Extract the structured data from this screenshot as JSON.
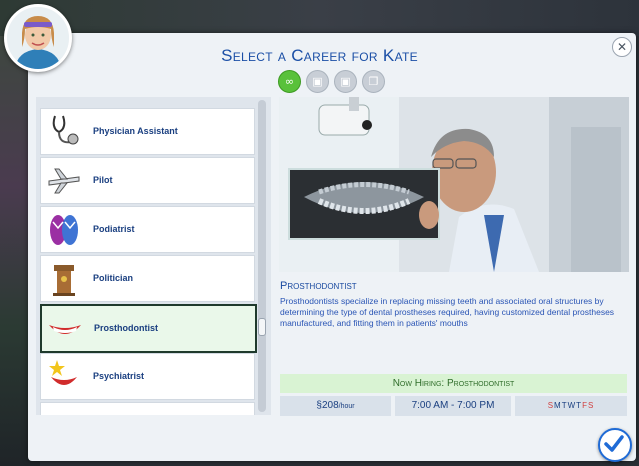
{
  "header": {
    "title": "Select a Career for Kate",
    "close_glyph": "✕"
  },
  "filters": [
    {
      "icon": "infinity-icon",
      "active": true
    },
    {
      "icon": "part-time-briefcase-icon",
      "active": false
    },
    {
      "icon": "freelance-briefcase-icon",
      "active": false
    },
    {
      "icon": "documents-icon",
      "active": false
    }
  ],
  "careers": [
    {
      "label": "Physician Assistant",
      "icon": "stethoscope-icon"
    },
    {
      "label": "Pilot",
      "icon": "airplane-icon"
    },
    {
      "label": "Podiatrist",
      "icon": "flip-flops-icon"
    },
    {
      "label": "Politician",
      "icon": "podium-icon"
    },
    {
      "label": "Prosthodontist",
      "icon": "smile-teeth-icon",
      "selected": true
    },
    {
      "label": "Psychiatrist",
      "icon": "mouth-star-icon"
    }
  ],
  "detail": {
    "title": "Prosthodontist",
    "description": "Prosthodontists specialize in replacing missing teeth and associated oral structures by determining the type of dental prostheses required, having customized dental prostheses manufactured, and fitting them in patients' mouths",
    "hiring": "Now Hiring: Prosthodontist",
    "pay_symbol": "§",
    "pay_amount": "208",
    "pay_unit": "/hour",
    "hours": "7:00 AM - 7:00 PM",
    "days": [
      {
        "letter": "S",
        "off": true
      },
      {
        "letter": "M",
        "off": false
      },
      {
        "letter": "T",
        "off": false
      },
      {
        "letter": "W",
        "off": false
      },
      {
        "letter": "T",
        "off": false
      },
      {
        "letter": "F",
        "off": true
      },
      {
        "letter": "S",
        "off": true
      }
    ]
  },
  "colors": {
    "title_blue": "#1b4fa6",
    "hiring_green": "#d9f3d3",
    "filter_active": "#59c13a",
    "day_off_red": "#d04040"
  }
}
